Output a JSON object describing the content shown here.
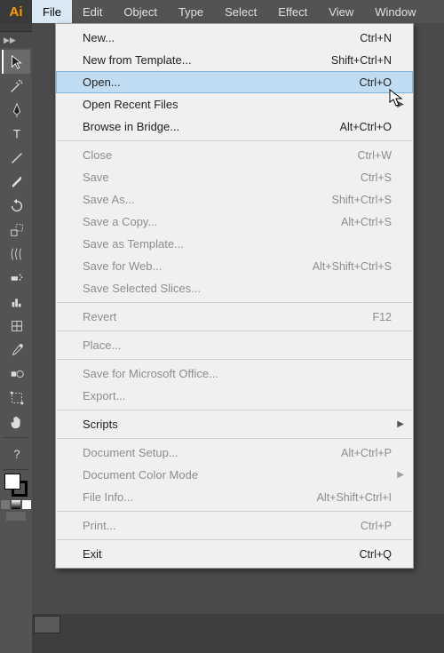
{
  "app": {
    "logo": "Ai"
  },
  "menubar": {
    "items": [
      "File",
      "Edit",
      "Object",
      "Type",
      "Select",
      "Effect",
      "View",
      "Window"
    ]
  },
  "dropdown": {
    "items": [
      {
        "label": "New...",
        "shortcut": "Ctrl+N",
        "enabled": true
      },
      {
        "label": "New from Template...",
        "shortcut": "Shift+Ctrl+N",
        "enabled": true
      },
      {
        "label": "Open...",
        "shortcut": "Ctrl+O",
        "enabled": true,
        "hover": true
      },
      {
        "label": "Open Recent Files",
        "submenu": true,
        "enabled": true
      },
      {
        "label": "Browse in Bridge...",
        "shortcut": "Alt+Ctrl+O",
        "enabled": true
      },
      {
        "sep": true
      },
      {
        "label": "Close",
        "shortcut": "Ctrl+W",
        "enabled": false
      },
      {
        "label": "Save",
        "shortcut": "Ctrl+S",
        "enabled": false
      },
      {
        "label": "Save As...",
        "shortcut": "Shift+Ctrl+S",
        "enabled": false
      },
      {
        "label": "Save a Copy...",
        "shortcut": "Alt+Ctrl+S",
        "enabled": false
      },
      {
        "label": "Save as Template...",
        "enabled": false
      },
      {
        "label": "Save for Web...",
        "shortcut": "Alt+Shift+Ctrl+S",
        "enabled": false
      },
      {
        "label": "Save Selected Slices...",
        "enabled": false
      },
      {
        "sep": true
      },
      {
        "label": "Revert",
        "shortcut": "F12",
        "enabled": false
      },
      {
        "sep": true
      },
      {
        "label": "Place...",
        "enabled": false
      },
      {
        "sep": true
      },
      {
        "label": "Save for Microsoft Office...",
        "enabled": false
      },
      {
        "label": "Export...",
        "enabled": false
      },
      {
        "sep": true
      },
      {
        "label": "Scripts",
        "submenu": true,
        "enabled": true
      },
      {
        "sep": true
      },
      {
        "label": "Document Setup...",
        "shortcut": "Alt+Ctrl+P",
        "enabled": false
      },
      {
        "label": "Document Color Mode",
        "submenu": true,
        "enabled": false
      },
      {
        "label": "File Info...",
        "shortcut": "Alt+Shift+Ctrl+I",
        "enabled": false
      },
      {
        "sep": true
      },
      {
        "label": "Print...",
        "shortcut": "Ctrl+P",
        "enabled": false
      },
      {
        "sep": true
      },
      {
        "label": "Exit",
        "shortcut": "Ctrl+Q",
        "enabled": true
      }
    ]
  },
  "tools": [
    "selection",
    "magic-wand",
    "pen",
    "type",
    "line",
    "brush",
    "rotate",
    "scale",
    "warp",
    "symbol-sprayer",
    "graph",
    "mesh",
    "eyedropper",
    "blend",
    "live-paint",
    "artboard",
    "slice",
    "hand"
  ]
}
